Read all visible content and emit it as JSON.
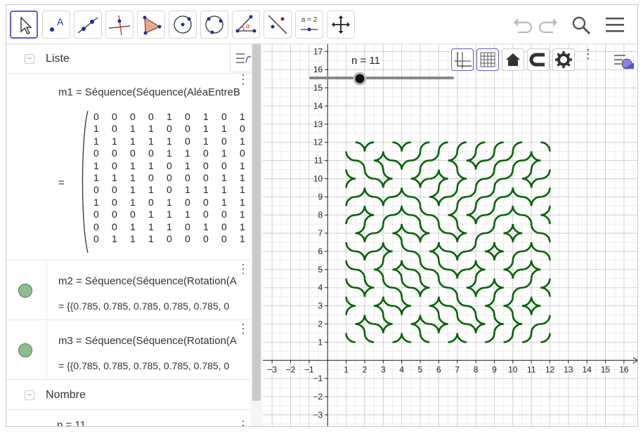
{
  "toolbar": {
    "tools": [
      {
        "name": "move-tool-button",
        "icon": "cursor-arrow-icon",
        "active": true
      },
      {
        "name": "point-tool-button",
        "icon": "point-icon",
        "text": "A"
      },
      {
        "name": "line-tool-button",
        "icon": "line-icon"
      },
      {
        "name": "perpendicular-tool-button",
        "icon": "perpendicular-line-icon"
      },
      {
        "name": "polygon-tool-button",
        "icon": "polygon-icon"
      },
      {
        "name": "circle-center-point-tool-button",
        "icon": "circle-center-icon"
      },
      {
        "name": "circle-three-points-tool-button",
        "icon": "circle-three-points-icon"
      },
      {
        "name": "angle-tool-button",
        "icon": "angle-icon",
        "text": "α"
      },
      {
        "name": "reflect-tool-button",
        "icon": "reflect-icon"
      },
      {
        "name": "slider-tool-button",
        "icon": "slider-icon",
        "text": "a = 2"
      },
      {
        "name": "move-graphics-tool-button",
        "icon": "move-graphics-icon"
      }
    ],
    "right": [
      "undo-icon",
      "redo-icon",
      "search-icon",
      "menu-icon"
    ]
  },
  "algebra": {
    "groups": {
      "liste": "Liste",
      "nombre": "Nombre"
    },
    "m1": {
      "definition": "m1 = Séquence(Séquence(AléaEntreB",
      "equals": "=",
      "matrix": [
        [
          "0",
          "0",
          "0",
          "0",
          "1",
          "0",
          "1",
          "0",
          "1"
        ],
        [
          "1",
          "0",
          "1",
          "1",
          "0",
          "0",
          "1",
          "1",
          "0"
        ],
        [
          "1",
          "1",
          "1",
          "1",
          "1",
          "0",
          "1",
          "0",
          "1"
        ],
        [
          "0",
          "0",
          "0",
          "0",
          "1",
          "1",
          "0",
          "1",
          "0"
        ],
        [
          "1",
          "0",
          "1",
          "1",
          "0",
          "1",
          "0",
          "0",
          "1"
        ],
        [
          "1",
          "1",
          "1",
          "0",
          "0",
          "0",
          "0",
          "1",
          "1"
        ],
        [
          "0",
          "0",
          "1",
          "1",
          "0",
          "1",
          "1",
          "1",
          "1"
        ],
        [
          "1",
          "0",
          "1",
          "0",
          "1",
          "0",
          "0",
          "1",
          "1"
        ],
        [
          "0",
          "0",
          "0",
          "1",
          "1",
          "1",
          "0",
          "0",
          "1"
        ],
        [
          "0",
          "0",
          "1",
          "1",
          "1",
          "0",
          "1",
          "0",
          "1"
        ],
        [
          "0",
          "1",
          "1",
          "1",
          "0",
          "0",
          "0",
          "0",
          "1"
        ]
      ]
    },
    "m2": {
      "definition": "m2 = Séquence(Séquence(Rotation(A",
      "value": "=  {{0.785, 0.785, 0.785, 0.785, 0.785, 0"
    },
    "m3": {
      "definition": "m3 = Séquence(Séquence(Rotation(A",
      "value": "=  {{0.785, 0.785, 0.785, 0.785, 0.785, 0"
    },
    "n": {
      "definition": "n = 11"
    },
    "colors": {
      "marble_fill": "#8fbc8f",
      "marble_border": "#4e7f4e"
    }
  },
  "graphics": {
    "slider": {
      "label": "n = 11",
      "value": 11
    },
    "x_ticks": [
      "−3",
      "−2",
      "−1",
      "1",
      "2",
      "3",
      "4",
      "5",
      "6",
      "7",
      "8",
      "9",
      "10",
      "11",
      "12",
      "13",
      "14",
      "15",
      "16"
    ],
    "y_ticks": [
      "17",
      "16",
      "15",
      "14",
      "13",
      "12",
      "11",
      "10",
      "9",
      "8",
      "7",
      "6",
      "5",
      "4",
      "3",
      "2",
      "1",
      "−1",
      "−2",
      "−3"
    ],
    "x_range": [
      -3.5,
      16.8
    ],
    "y_range": [
      -3.7,
      17.4
    ],
    "tiling": {
      "color": "#006400",
      "x_range": [
        1,
        12
      ],
      "y_range": [
        1,
        12
      ],
      "n": 11
    },
    "style_bar_buttons": [
      "axes-toggle-icon",
      "grid-toggle-icon",
      "home-icon",
      "magnet-icon",
      "gear-icon",
      "kebab-icon"
    ],
    "colors": {
      "grid": "#d6d6d6",
      "axes": "#222222",
      "accent": "#6557d2"
    }
  }
}
